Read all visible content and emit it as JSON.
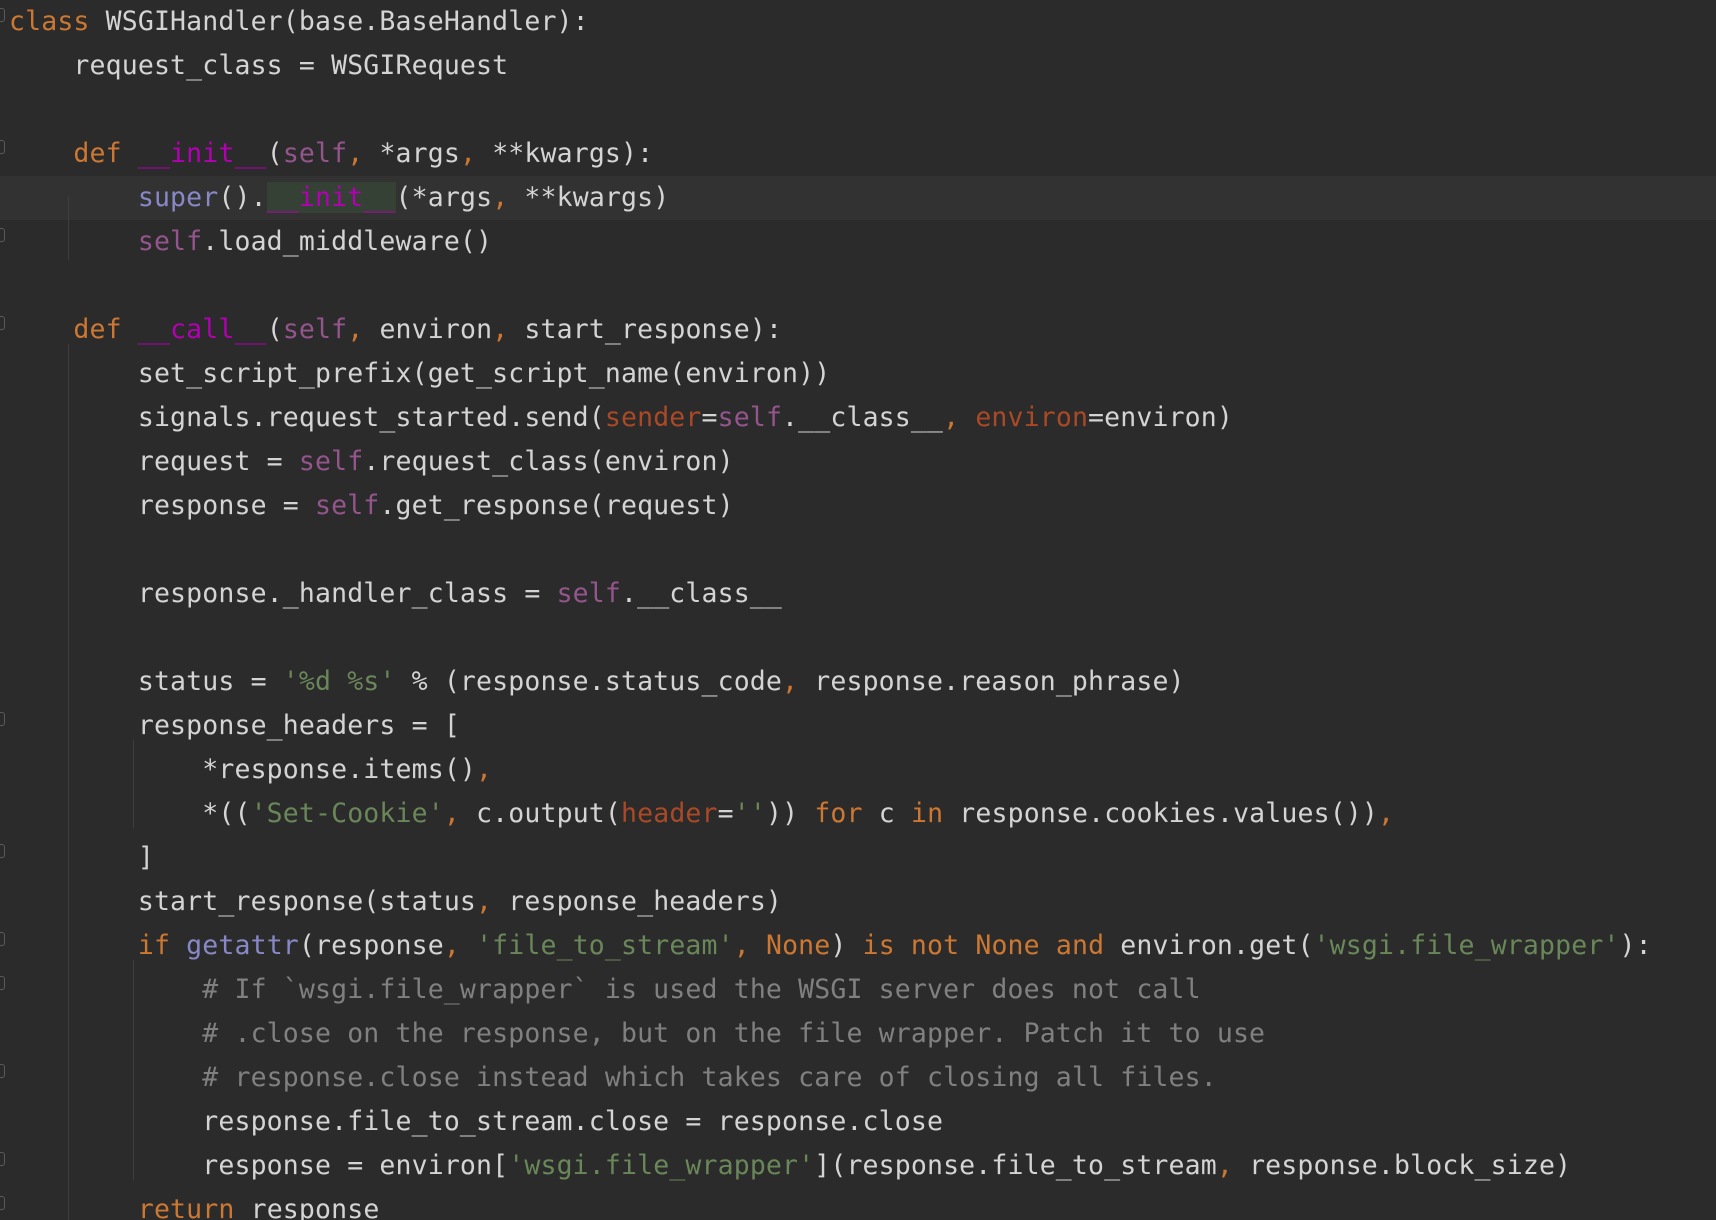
{
  "editor": {
    "language": "python",
    "current_line_index": 4,
    "lines": [
      [
        {
          "t": "class",
          "c": "kw"
        },
        {
          "t": " WSGIHandler(base.BaseHandler):"
        }
      ],
      [
        {
          "t": "    request_class = WSGIRequest"
        }
      ],
      [],
      [
        {
          "t": "    "
        },
        {
          "t": "def",
          "c": "kw"
        },
        {
          "t": " "
        },
        {
          "t": "__init__",
          "c": "fn"
        },
        {
          "t": "("
        },
        {
          "t": "self",
          "c": "sf"
        },
        {
          "t": ", ",
          "c": "kw"
        },
        {
          "t": "*args"
        },
        {
          "t": ", ",
          "c": "kw"
        },
        {
          "t": "**kwargs):"
        }
      ],
      [
        {
          "t": "        "
        },
        {
          "t": "super",
          "c": "bi"
        },
        {
          "t": "()."
        },
        {
          "t": "__init__",
          "c": "fn hl"
        },
        {
          "t": "(*args"
        },
        {
          "t": ", ",
          "c": "kw"
        },
        {
          "t": "**kwargs)"
        }
      ],
      [
        {
          "t": "        "
        },
        {
          "t": "self",
          "c": "sf"
        },
        {
          "t": ".load_middleware()"
        }
      ],
      [],
      [
        {
          "t": "    "
        },
        {
          "t": "def",
          "c": "kw"
        },
        {
          "t": " "
        },
        {
          "t": "__call__",
          "c": "fn"
        },
        {
          "t": "("
        },
        {
          "t": "self",
          "c": "sf"
        },
        {
          "t": ", ",
          "c": "kw"
        },
        {
          "t": "environ"
        },
        {
          "t": ", ",
          "c": "kw"
        },
        {
          "t": "start_response):"
        }
      ],
      [
        {
          "t": "        set_script_prefix(get_script_name(environ))"
        }
      ],
      [
        {
          "t": "        signals.request_started.send("
        },
        {
          "t": "sender",
          "c": "pr"
        },
        {
          "t": "="
        },
        {
          "t": "self",
          "c": "sf"
        },
        {
          "t": ".__class__"
        },
        {
          "t": ", ",
          "c": "kw"
        },
        {
          "t": "environ",
          "c": "pr"
        },
        {
          "t": "=environ)"
        }
      ],
      [
        {
          "t": "        request = "
        },
        {
          "t": "self",
          "c": "sf"
        },
        {
          "t": ".request_class(environ)"
        }
      ],
      [
        {
          "t": "        response = "
        },
        {
          "t": "self",
          "c": "sf"
        },
        {
          "t": ".get_response(request)"
        }
      ],
      [],
      [
        {
          "t": "        response._handler_class = "
        },
        {
          "t": "self",
          "c": "sf"
        },
        {
          "t": ".__class__"
        }
      ],
      [],
      [
        {
          "t": "        status = "
        },
        {
          "t": "'%d %s'",
          "c": "str"
        },
        {
          "t": " % (response.status_code"
        },
        {
          "t": ", ",
          "c": "kw"
        },
        {
          "t": "response.reason_phrase)"
        }
      ],
      [
        {
          "t": "        response_headers = ["
        }
      ],
      [
        {
          "t": "            *response.items()"
        },
        {
          "t": ",",
          "c": "kw"
        }
      ],
      [
        {
          "t": "            *(("
        },
        {
          "t": "'Set-Cookie'",
          "c": "str"
        },
        {
          "t": ", ",
          "c": "kw"
        },
        {
          "t": "c.output("
        },
        {
          "t": "header",
          "c": "pr"
        },
        {
          "t": "="
        },
        {
          "t": "''",
          "c": "str"
        },
        {
          "t": ")) "
        },
        {
          "t": "for",
          "c": "kw"
        },
        {
          "t": " c "
        },
        {
          "t": "in",
          "c": "kw"
        },
        {
          "t": " response.cookies.values())"
        },
        {
          "t": ",",
          "c": "kw"
        }
      ],
      [
        {
          "t": "        ]"
        }
      ],
      [
        {
          "t": "        start_response(status"
        },
        {
          "t": ", ",
          "c": "kw"
        },
        {
          "t": "response_headers)"
        }
      ],
      [
        {
          "t": "        "
        },
        {
          "t": "if",
          "c": "kw"
        },
        {
          "t": " "
        },
        {
          "t": "getattr",
          "c": "bi"
        },
        {
          "t": "(response"
        },
        {
          "t": ", ",
          "c": "kw"
        },
        {
          "t": "'file_to_stream'",
          "c": "str"
        },
        {
          "t": ", ",
          "c": "kw"
        },
        {
          "t": "None",
          "c": "kw"
        },
        {
          "t": ") "
        },
        {
          "t": "is not None and",
          "c": "kw"
        },
        {
          "t": " environ.get("
        },
        {
          "t": "'wsgi.file_wrapper'",
          "c": "str"
        },
        {
          "t": "):"
        }
      ],
      [
        {
          "t": "            "
        },
        {
          "t": "# If `wsgi.file_wrapper` is used the WSGI server does not call",
          "c": "cm"
        }
      ],
      [
        {
          "t": "            "
        },
        {
          "t": "# .close on the response, but on the file wrapper. Patch it to use",
          "c": "cm"
        }
      ],
      [
        {
          "t": "            "
        },
        {
          "t": "# response.close instead which takes care of closing all files.",
          "c": "cm"
        }
      ],
      [
        {
          "t": "            response.file_to_stream.close = response.close"
        }
      ],
      [
        {
          "t": "            response = environ["
        },
        {
          "t": "'wsgi.file_wrapper'",
          "c": "str"
        },
        {
          "t": "](response.file_to_stream"
        },
        {
          "t": ", ",
          "c": "kw"
        },
        {
          "t": "response.block_size)"
        }
      ],
      [
        {
          "t": "        "
        },
        {
          "t": "return",
          "c": "kw"
        },
        {
          "t": " response"
        }
      ]
    ]
  },
  "colors": {
    "background": "#2b2b2b",
    "current_line": "#323232",
    "default_text": "#d4d4d4",
    "keyword": "#cc7832",
    "dunder_function": "#b200b2",
    "self_keyword": "#94558d",
    "builtin": "#8888c6",
    "string": "#6a8759",
    "comment": "#808080",
    "named_argument": "#aa4926",
    "usage_highlight": "#344134"
  }
}
